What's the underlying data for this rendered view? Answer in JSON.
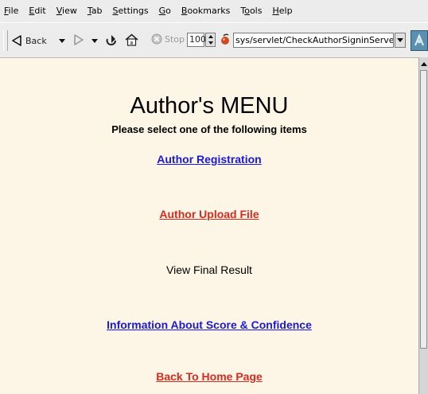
{
  "browser": {
    "menu": [
      {
        "pre": "",
        "u": "F",
        "post": "ile"
      },
      {
        "pre": "",
        "u": "E",
        "post": "dit"
      },
      {
        "pre": "",
        "u": "V",
        "post": "iew"
      },
      {
        "pre": "",
        "u": "T",
        "post": "ab"
      },
      {
        "pre": "",
        "u": "S",
        "post": "ettings"
      },
      {
        "pre": "",
        "u": "G",
        "post": "o"
      },
      {
        "pre": "",
        "u": "B",
        "post": "ookmarks"
      },
      {
        "pre": "T",
        "u": "o",
        "post": "ols"
      },
      {
        "pre": "",
        "u": "H",
        "post": "elp"
      }
    ],
    "toolbar": {
      "back_label": "Back",
      "stop_label": "Stop",
      "zoom_value": "100",
      "url_value": "sys/servlet/CheckAuthorSigninServer"
    },
    "colors": {
      "page_background": "#fdf5e6",
      "link_blue": "#1a1ad6",
      "link_visited": "#d62b1e"
    },
    "icons": [
      "back-icon",
      "forward-icon",
      "reload-icon",
      "home-icon",
      "stop-icon",
      "security-icon",
      "throbber-icon"
    ]
  },
  "page": {
    "title": "Author's MENU",
    "subtitle": "Please select one of the following items",
    "links": [
      {
        "label": "Author Registration",
        "state": "link"
      },
      {
        "label": "Author Upload File",
        "state": "visited"
      },
      {
        "label": "View Final Result",
        "state": "plain"
      },
      {
        "label": "Information About Score & Confidence",
        "state": "link"
      },
      {
        "label": "Back To Home Page",
        "state": "visited"
      }
    ]
  }
}
